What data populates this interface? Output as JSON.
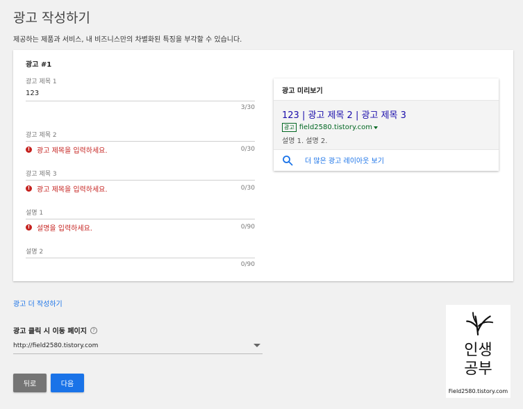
{
  "page": {
    "title": "광고 작성하기",
    "subtitle": "제공하는 제품과 서비스, 내 비즈니스만의 차별화된 특징을 부각할 수 있습니다."
  },
  "ad_card": {
    "title": "광고 #1",
    "fields": [
      {
        "label": "광고 제목 1",
        "value": "123",
        "error": "",
        "counter": "3/30"
      },
      {
        "label": "광고 제목 2",
        "value": "",
        "error": "광고 제목을 입력하세요.",
        "counter": "0/30"
      },
      {
        "label": "광고 제목 3",
        "value": "",
        "error": "광고 제목을 입력하세요.",
        "counter": "0/30"
      },
      {
        "label": "설명 1",
        "value": "",
        "error": "설명을 입력하세요.",
        "counter": "0/90"
      },
      {
        "label": "설명 2",
        "value": "",
        "error": "",
        "counter": "0/90"
      }
    ]
  },
  "preview": {
    "header": "광고 미리보기",
    "headline": "123 | 광고 제목 2 | 광고 제목 3",
    "ad_badge": "광고",
    "display_url": "field2580.tistory.com",
    "description": "설명 1. 설명 2.",
    "more_layouts": "더 많은 광고 레이아웃 보기"
  },
  "more_ads_link": "광고 더 작성하기",
  "final_url": {
    "label": "광고 클릭 시 이동 페이지",
    "help_glyph": "?",
    "value": "http://field2580.tistory.com"
  },
  "buttons": {
    "back": "뒤로",
    "next": "다음"
  },
  "watermark": {
    "line1": "인생",
    "line2": "공부",
    "caption": "Field2580.tistory.com"
  },
  "error_glyph": "!",
  "colors": {
    "link_blue": "#1a73e8",
    "error_red": "#c5221f",
    "ad_headline": "#1a0dab",
    "ad_url_green": "#006621"
  }
}
